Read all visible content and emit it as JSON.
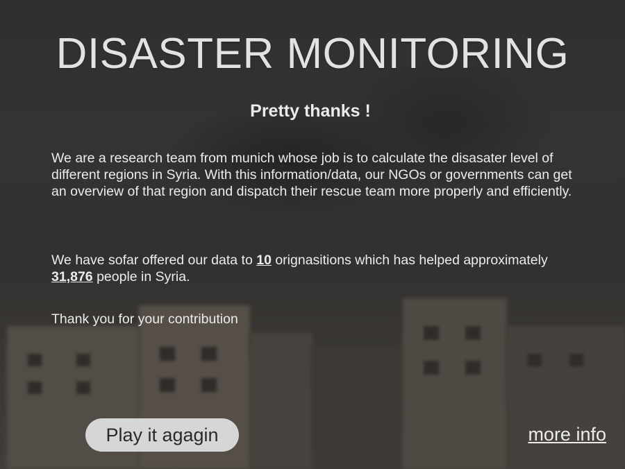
{
  "header": {
    "title": "DISASTER MONITORING",
    "subtitle": "Pretty thanks !"
  },
  "intro": {
    "text": "We are a research team from munich whose job is to calculate the disasater level of different regions in Syria. With this information/data, our NGOs or governments can get an overview of that region and dispatch their rescue team more properly and efficiently."
  },
  "stats": {
    "prefix": "We have sofar offered our data to ",
    "organisations": "10",
    "middle": " orignasitions which has helped approximately ",
    "people": "31,876",
    "suffix": " people in Syria."
  },
  "thanks": {
    "text": "Thank you for your contribution"
  },
  "actions": {
    "play_label": "Play it agagin",
    "more_info_label": "more info"
  }
}
